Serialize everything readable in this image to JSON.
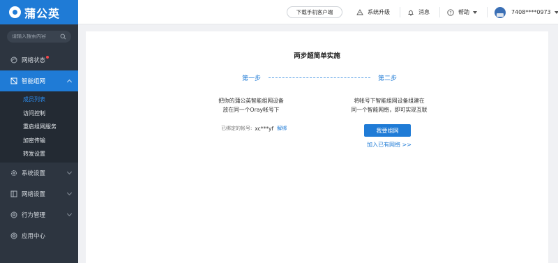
{
  "app": {
    "logo_text": "蒲公英"
  },
  "sidebar": {
    "search_placeholder": "请输入搜索内容",
    "items": [
      {
        "label": "网络状态",
        "icon": "network-status-icon"
      },
      {
        "label": "智能组网",
        "icon": "smart-network-icon"
      },
      {
        "label": "系统设置",
        "icon": "gear-icon"
      },
      {
        "label": "网络设置",
        "icon": "network-settings-icon"
      },
      {
        "label": "行为管理",
        "icon": "behavior-icon"
      },
      {
        "label": "应用中心",
        "icon": "app-center-icon"
      }
    ],
    "sub_items": [
      {
        "label": "成员列表"
      },
      {
        "label": "访问控制"
      },
      {
        "label": "重启组网服务"
      },
      {
        "label": "加密传输"
      },
      {
        "label": "转发设置"
      }
    ]
  },
  "topbar": {
    "download_app": "下载手机客户端",
    "upgrade": "系统升级",
    "messages": "消息",
    "help": "帮助",
    "account": "7408****0973"
  },
  "main": {
    "title": "两步超简单实施",
    "step1": "第一步",
    "step2": "第二步",
    "step1_desc_line1": "把你的蒲公英智能组网设备",
    "step1_desc_line2": "放在同一个Oray帐号下",
    "bound_label": "已绑定的帐号:",
    "bound_account": "xc***yf",
    "unbind": "解绑",
    "step2_desc_line1": "将帐号下智能组网设备组建在",
    "step2_desc_line2": "同一个智能网络，即可实现互联",
    "create_button": "我要组网",
    "join_link": "加入已有网络 >>"
  },
  "colors": {
    "accent": "#1f7bd6",
    "sidebar_bg": "#2d3540",
    "submenu_bg": "#232a33"
  }
}
